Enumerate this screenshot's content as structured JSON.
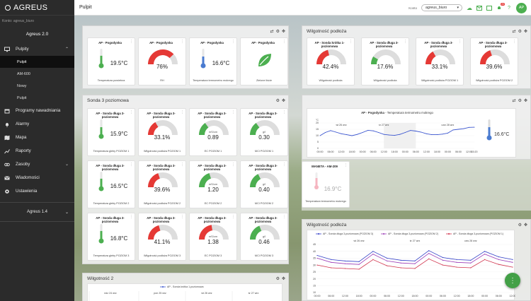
{
  "app": {
    "logo": "AGREUS",
    "account": "Konto: agreus_biuro",
    "org": "Agreus 2.0",
    "version": "Agreus 1.4"
  },
  "sidebar": {
    "items": [
      {
        "label": "Pulpity",
        "icon": "monitor-icon"
      },
      {
        "label": "Programy nawadniania",
        "icon": "calendar-icon"
      },
      {
        "label": "Alarmy",
        "icon": "bell-icon"
      },
      {
        "label": "Mapa",
        "icon": "map-icon"
      },
      {
        "label": "Raporty",
        "icon": "chart-icon"
      },
      {
        "label": "Zasoby",
        "icon": "link-icon"
      },
      {
        "label": "Wiadomości",
        "icon": "mail-icon"
      },
      {
        "label": "Ustawienia",
        "icon": "gear-icon"
      }
    ],
    "subitems": [
      "Pulpit",
      "AM-600",
      "Nowy",
      "Pulpit"
    ]
  },
  "topbar": {
    "title": "Pulpit",
    "konto_label": "Konto",
    "konto_value": "agreus_biuro",
    "notif_count": "20",
    "avatar": "AP",
    "help": "?"
  },
  "panels": {
    "p1": {
      "tiles": [
        {
          "title": "AP - Pogodynka",
          "value": "19.5°C",
          "caption": "Temperatura powietrza"
        },
        {
          "title": "AP - Pogodynka",
          "value": "76%",
          "caption": "RH"
        },
        {
          "title": "AP - Pogodynka",
          "value": "16.6°C",
          "caption": "Temperatura termometru mokrego"
        },
        {
          "title": "AP - Pogodynka",
          "caption": "Zielone liście"
        }
      ]
    },
    "p2": {
      "title": "Wilgotność podłoża",
      "tiles": [
        {
          "title": "AP - Sonda krótka 1-poziomowa",
          "value": "42.4%",
          "caption": "Wilgotność podłoża"
        },
        {
          "title": "AP - Sonda długa 3-poziomowa",
          "value": "17.6%",
          "caption": "Wilgotność podłoża"
        },
        {
          "title": "AP - Sonda długa 3-poziomowa",
          "value": "33.1%",
          "caption": "Wilgotność podłoża POZIOM 1"
        },
        {
          "title": "AP - Sonda długa 3-poziomowa",
          "value": "39.6%",
          "caption": "Wilgotność podłoża POZIOM 2"
        }
      ]
    },
    "p3": {
      "title": "Sonda 3 poziomowa",
      "tiles": [
        {
          "title": "AP - Sonda długa 3-poziomowa",
          "value": "15.9°C",
          "caption": "Temperatura gleby POZIOM 1"
        },
        {
          "title": "AP - Sonda długa 3-poziomowa",
          "value": "33.1%",
          "caption": "Wilgotność podłoża POZIOM 1"
        },
        {
          "title": "AP - Sonda długa 3-poziomowa",
          "value": "0.89",
          "unit": "mS/cm",
          "caption": "EC POZIOM 1"
        },
        {
          "title": "AP - Sonda długa 3-poziomowa",
          "value": "0.30",
          "unit": "g/l",
          "caption": "MCI POZIOM 1"
        },
        {
          "title": "AP - Sonda długa 3-poziomowa",
          "value": "16.5°C",
          "caption": "Temperatura gleby POZIOM 2"
        },
        {
          "title": "AP - Sonda długa 3-poziomowa",
          "value": "39.6%",
          "caption": "Wilgotność podłoża POZIOM 2"
        },
        {
          "title": "AP - Sonda długa 3-poziomowa",
          "value": "1.20",
          "unit": "mS/cm",
          "caption": "EC POZIOM 2"
        },
        {
          "title": "AP - Sonda długa 3-poziomowa",
          "value": "0.40",
          "unit": "g/l",
          "caption": "MCI POZIOM 2"
        },
        {
          "title": "AP - Sonda długa 3-poziomowa",
          "value": "16.8°C",
          "caption": "Temperatura gleby POZIOM 3"
        },
        {
          "title": "AP - Sonda długa 3-poziomowa",
          "value": "41.1%",
          "caption": "Wilgotność podłoża POZIOM 3"
        },
        {
          "title": "AP - Sonda długa 3-poziomowa",
          "value": "1.38",
          "unit": "mS/cm",
          "caption": "EC POZIOM 3"
        },
        {
          "title": "AP - Sonda długa 3-poziomowa",
          "value": "0.46",
          "unit": "g/l",
          "caption": "MCI POZIOM 3"
        }
      ]
    },
    "p4": {
      "chart_title": "AP - Pogodynka",
      "chart_subtitle": "Temperatura termometru mokrego",
      "value": "16.6°C"
    },
    "p5": {
      "tile": {
        "title": "MANETA - AM-209",
        "value": "16.9°C",
        "caption": "Temperatura termometru mokrego"
      }
    },
    "p6": {
      "title": "Wilgotność podłoża"
    },
    "p7": {
      "title": "Wilgotność 2"
    }
  },
  "chart_data": [
    {
      "type": "line",
      "title": "AP - Pogodynka - Temperatura termometru mokrego",
      "ylabel": "°C",
      "x": [
        "00:00",
        "03:00",
        "06:00",
        "09:00",
        "12:00",
        "15:00",
        "18:00",
        "21:00",
        "00:00",
        "03:00",
        "06:00",
        "09:00",
        "12:00",
        "15:00",
        "18:00",
        "21:00",
        "00:00",
        "03:00",
        "06:00",
        "09:00",
        "12:00",
        "15:00",
        "18:00",
        "21:00",
        "00:00",
        "03:00",
        "06:00",
        "09:00",
        "12:00",
        "15:20"
      ],
      "date_labels": [
        "wt 26 wrz",
        "śr 27 wrz",
        "czw 28 wrz"
      ],
      "yticks": [
        "20",
        "15",
        "10",
        "5",
        "0"
      ],
      "ylim": [
        0,
        20
      ],
      "series": [
        {
          "values": [
            10,
            12.5,
            14,
            12.8,
            11.5,
            10.8,
            10,
            11,
            12.5,
            14.2,
            13.8,
            12.5,
            11,
            10.5,
            10.2,
            11,
            12.5,
            14.1,
            13.6,
            12.8,
            11.5,
            10.8,
            10.8,
            11.2,
            12,
            14.5,
            15,
            15.5,
            16.5,
            16.6
          ],
          "color": "#3a55cf"
        }
      ]
    },
    {
      "type": "line",
      "title": "Wilgotność podłoża",
      "x_labels": [
        "00:00",
        "06:00",
        "12:00",
        "18:00",
        "00:00",
        "06:00",
        "12:00",
        "18:00",
        "00:00",
        "06:00",
        "12:00",
        "18:00",
        "00:00",
        "06:00",
        "12:00"
      ],
      "date_labels": [
        "wt 26 wrz",
        "śr 27 wrz",
        "czw 28 wrz"
      ],
      "yticks": [
        "45",
        "40",
        "35",
        "30",
        "25",
        "20",
        "15",
        "10"
      ],
      "ylim": [
        10,
        45
      ],
      "series": [
        {
          "name": "AP - Sonda długa 3-poziomowa (POZIOM 3)",
          "color": "#3340c8",
          "values": [
            37,
            34,
            33,
            32.5,
            40,
            35,
            33.5,
            33,
            40.5,
            35.5,
            34,
            33.5,
            40,
            36,
            34
          ]
        },
        {
          "name": "AP - Sonda długa 3-poziomowa (POZIOM 2)",
          "color": "#9b3cb7",
          "values": [
            35,
            32,
            31,
            30.5,
            38,
            33,
            31.5,
            31,
            38.5,
            33.5,
            32,
            31.5,
            38,
            34,
            32
          ]
        },
        {
          "name": "AP - Sonda długa 3-poziomowa (POZIOM 1)",
          "color": "#d0304a",
          "values": [
            30,
            28,
            27.5,
            27,
            34,
            29.5,
            28,
            27.5,
            34.5,
            30,
            28.5,
            28,
            34,
            30.5,
            28.5
          ]
        }
      ]
    },
    {
      "type": "line",
      "title": "Wilgotność 2",
      "date_labels": [
        "ndz 24 wrz",
        "pon 25 wrz",
        "wt 26 wrz",
        "śr 27 wrz"
      ],
      "series": [
        {
          "name": "AP - Sonda krótka 1-poziomowa",
          "color": "#3a55cf",
          "values": []
        }
      ]
    }
  ],
  "colors": {
    "green": "#4caf50",
    "red": "#e53935",
    "sidebar": "#2b2b2b",
    "thermo_blue": "#4a7bd0"
  }
}
